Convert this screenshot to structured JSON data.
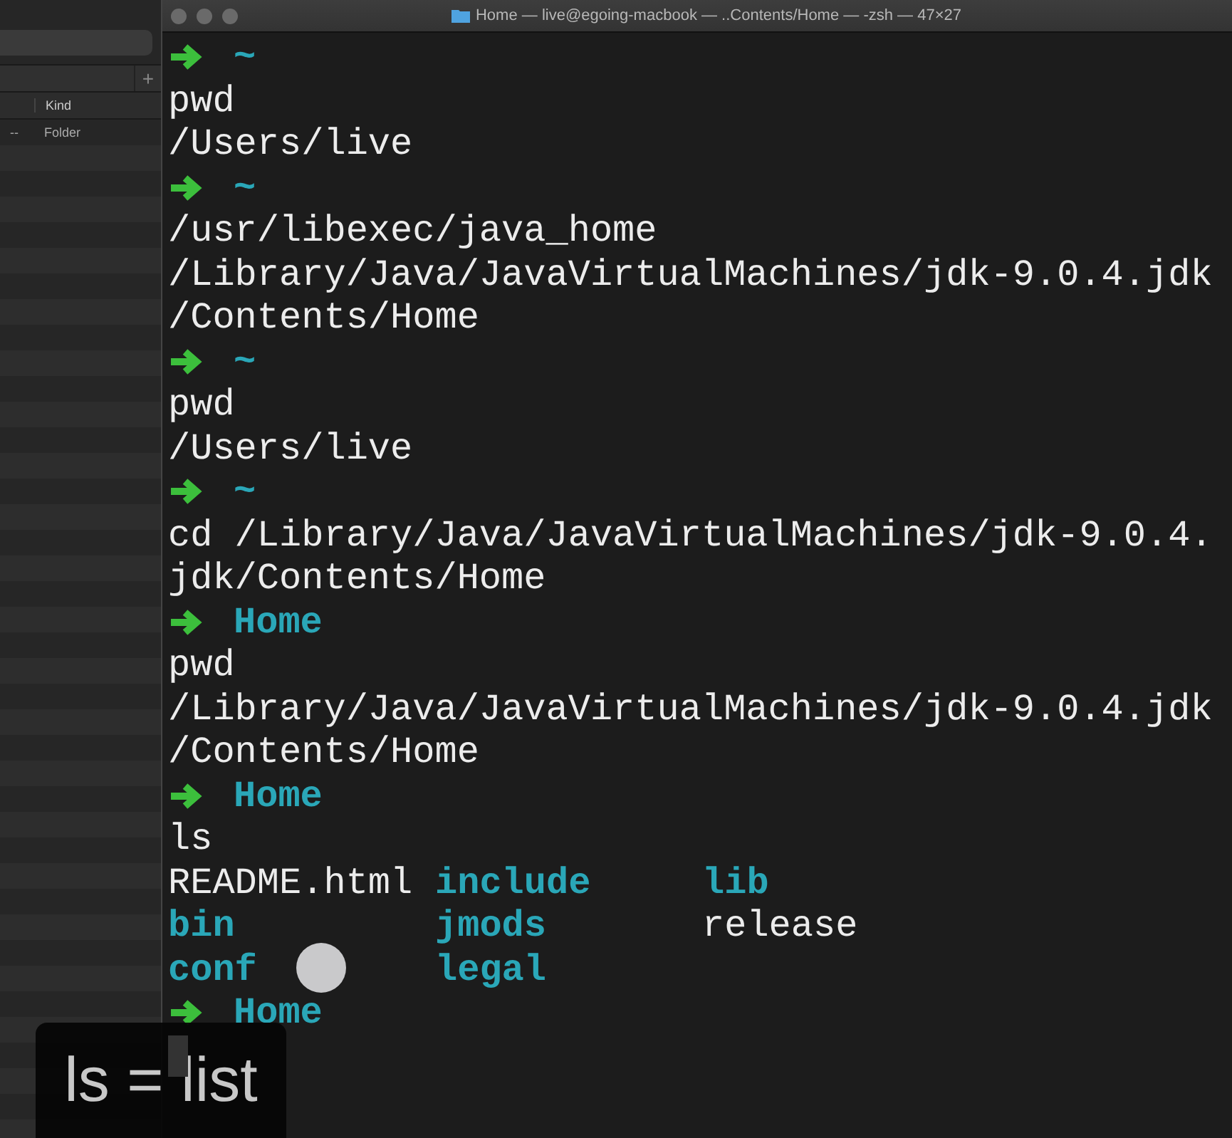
{
  "finder": {
    "column_header": "Kind",
    "row": {
      "size": "--",
      "kind": "Folder"
    },
    "add_tab": "+"
  },
  "terminal": {
    "title": "Home — live@egoing-macbook — ..Contents/Home — -zsh — 47×27",
    "lines": [
      {
        "kind": "prompt",
        "dir": "~"
      },
      {
        "kind": "text",
        "text": "pwd"
      },
      {
        "kind": "text",
        "text": "/Users/live"
      },
      {
        "kind": "prompt",
        "dir": "~"
      },
      {
        "kind": "text",
        "text": "/usr/libexec/java_home"
      },
      {
        "kind": "text",
        "text": "/Library/Java/JavaVirtualMachines/jdk-9.0.4.jdk"
      },
      {
        "kind": "text",
        "text": "/Contents/Home"
      },
      {
        "kind": "prompt",
        "dir": "~"
      },
      {
        "kind": "text",
        "text": "pwd"
      },
      {
        "kind": "text",
        "text": "/Users/live"
      },
      {
        "kind": "prompt",
        "dir": "~"
      },
      {
        "kind": "text",
        "text": "cd /Library/Java/JavaVirtualMachines/jdk-9.0.4."
      },
      {
        "kind": "text",
        "text": "jdk/Contents/Home"
      },
      {
        "kind": "prompt",
        "dir": "Home"
      },
      {
        "kind": "text",
        "text": "pwd"
      },
      {
        "kind": "text",
        "text": "/Library/Java/JavaVirtualMachines/jdk-9.0.4.jdk"
      },
      {
        "kind": "text",
        "text": "/Contents/Home"
      },
      {
        "kind": "prompt",
        "dir": "Home"
      },
      {
        "kind": "text",
        "text": "ls"
      },
      {
        "kind": "listing",
        "entries": [
          {
            "name": "README.html",
            "kind": "file"
          },
          {
            "name": "include",
            "kind": "directory"
          },
          {
            "name": "lib",
            "kind": "directory"
          }
        ]
      },
      {
        "kind": "listing",
        "entries": [
          {
            "name": "bin",
            "kind": "directory"
          },
          {
            "name": "jmods",
            "kind": "directory"
          },
          {
            "name": "release",
            "kind": "file"
          }
        ]
      },
      {
        "kind": "listing",
        "entries": [
          {
            "name": "conf",
            "kind": "directory"
          },
          {
            "name": "legal",
            "kind": "directory"
          }
        ]
      },
      {
        "kind": "prompt",
        "dir": "Home"
      },
      {
        "kind": "cursor"
      }
    ]
  },
  "caption": "ls = list"
}
